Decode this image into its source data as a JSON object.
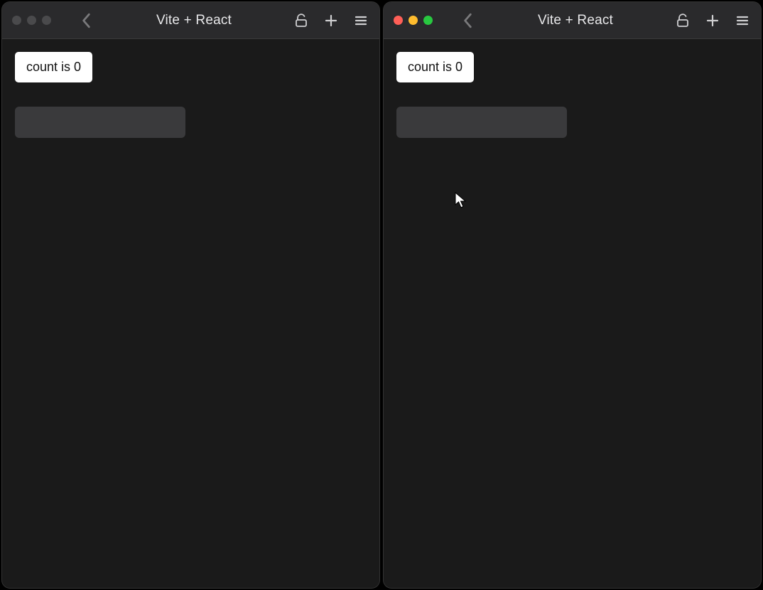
{
  "windows": [
    {
      "title": "Vite + React",
      "active": false,
      "count_button_label": "count is 0",
      "input_value": ""
    },
    {
      "title": "Vite + React",
      "active": true,
      "count_button_label": "count is 0",
      "input_value": ""
    }
  ]
}
